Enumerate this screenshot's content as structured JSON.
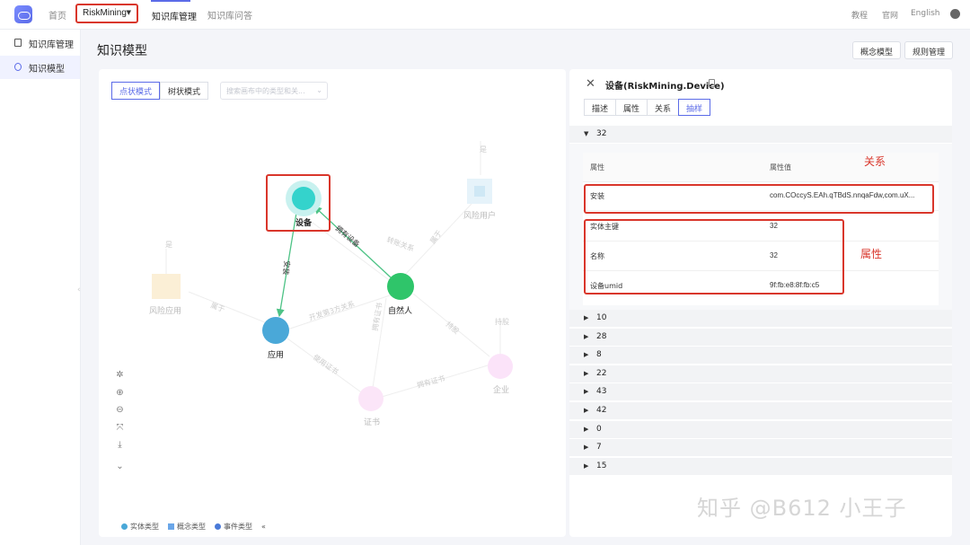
{
  "topbar": {
    "home": "首页",
    "namespace": "RiskMining",
    "nav_kb_manage": "知识库管理",
    "nav_kb_qa": "知识库问答",
    "tutorial": "教程",
    "website": "官网",
    "language": "English"
  },
  "sidebar": {
    "items": [
      {
        "label": "知识库管理"
      },
      {
        "label": "知识模型"
      }
    ]
  },
  "page": {
    "title": "知识模型",
    "concept_model_button": "概念模型",
    "rule_manage_button": "规则管理"
  },
  "graph": {
    "mode_point": "点状模式",
    "mode_tree": "树状模式",
    "search_placeholder": "搜索画布中的类型和关...",
    "nodes": {
      "device": "设备",
      "person": "自然人",
      "app": "应用",
      "risk_user": "风险用户",
      "risk_app": "风险应用",
      "company": "企业",
      "cert": "证书"
    },
    "edges": {
      "owns_device": "拥有设备",
      "install": "安装",
      "belongs": "属于",
      "transfer": "转账关系",
      "dev_relation": "开发第3方关系",
      "use_cert": "使用证书",
      "own_cert": "拥有证书",
      "holds": "持股",
      "is": "是",
      "belongs2": "属于",
      "holds2": "持股",
      "is2": "是"
    },
    "legend": {
      "entity": "实体类型",
      "concept": "概念类型",
      "event": "事件类型"
    },
    "colors": {
      "device": "#34d3cc",
      "person": "#2fc56a",
      "app": "#4aa8d8",
      "risk_user": "#8fd0ea",
      "risk_app": "#f3d28f",
      "company": "#f2b8ef",
      "cert": "#f5c1ee",
      "edge": "#4ec386",
      "annotation": "#d9362b",
      "accent": "#5b6be8"
    }
  },
  "detail": {
    "title": "设备(RiskMining.Device)",
    "tabs": [
      "描述",
      "属性",
      "关系",
      "抽样"
    ],
    "expanded_group": "32",
    "col_attr": "属性",
    "col_value": "属性值",
    "relation_row": {
      "key": "安装",
      "value": "com.COccyS.EAh.qTBdS.nnqaFdw,com.uX..."
    },
    "props": [
      {
        "key": "实体主键",
        "value": "32"
      },
      {
        "key": "名称",
        "value": "32"
      },
      {
        "key": "设备umid",
        "value": "9f:fb:e8:8f:fb:c5"
      }
    ],
    "annotation_relation": "关系",
    "annotation_attr": "属性",
    "groups": [
      "10",
      "28",
      "8",
      "22",
      "43",
      "42",
      "0",
      "7",
      "15"
    ]
  },
  "watermark": "知乎 @B612 小王子"
}
